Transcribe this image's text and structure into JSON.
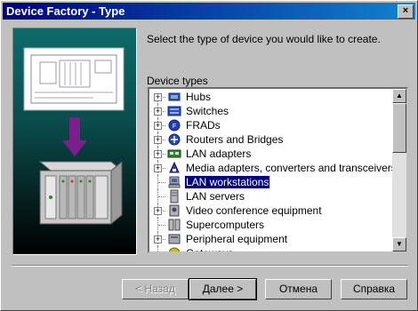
{
  "window": {
    "title": "Device Factory - Type",
    "close_label": "×"
  },
  "instruction": "Select the type of device you would like to create.",
  "tree": {
    "label": "Device types",
    "items": [
      {
        "label": "Hubs",
        "expandable": true,
        "icon": "hub-icon",
        "selected": false
      },
      {
        "label": "Switches",
        "expandable": true,
        "icon": "switch-icon",
        "selected": false
      },
      {
        "label": "FRADs",
        "expandable": true,
        "icon": "frad-icon",
        "selected": false
      },
      {
        "label": "Routers and Bridges",
        "expandable": true,
        "icon": "router-icon",
        "selected": false
      },
      {
        "label": "LAN adapters",
        "expandable": true,
        "icon": "lan-adapter-icon",
        "selected": false
      },
      {
        "label": "Media adapters, converters and transceivers",
        "expandable": true,
        "icon": "media-adapter-icon",
        "selected": false
      },
      {
        "label": "LAN workstations",
        "expandable": false,
        "icon": "workstation-icon",
        "selected": true
      },
      {
        "label": "LAN servers",
        "expandable": false,
        "icon": "server-icon",
        "selected": false
      },
      {
        "label": "Video conference equipment",
        "expandable": true,
        "icon": "video-conference-icon",
        "selected": false
      },
      {
        "label": "Supercomputers",
        "expandable": false,
        "icon": "supercomputer-icon",
        "selected": false
      },
      {
        "label": "Peripheral equipment",
        "expandable": true,
        "icon": "peripheral-icon",
        "selected": false
      },
      {
        "label": "Gateways",
        "expandable": false,
        "icon": "gateway-icon",
        "selected": false
      }
    ]
  },
  "buttons": {
    "back": "< Назад",
    "next": "Далее >",
    "cancel": "Отмена",
    "help": "Справка"
  },
  "colors": {
    "titlebar": "#000080",
    "selection": "#000080",
    "face": "#c0c0c0",
    "panel": "#0e6a6a"
  }
}
